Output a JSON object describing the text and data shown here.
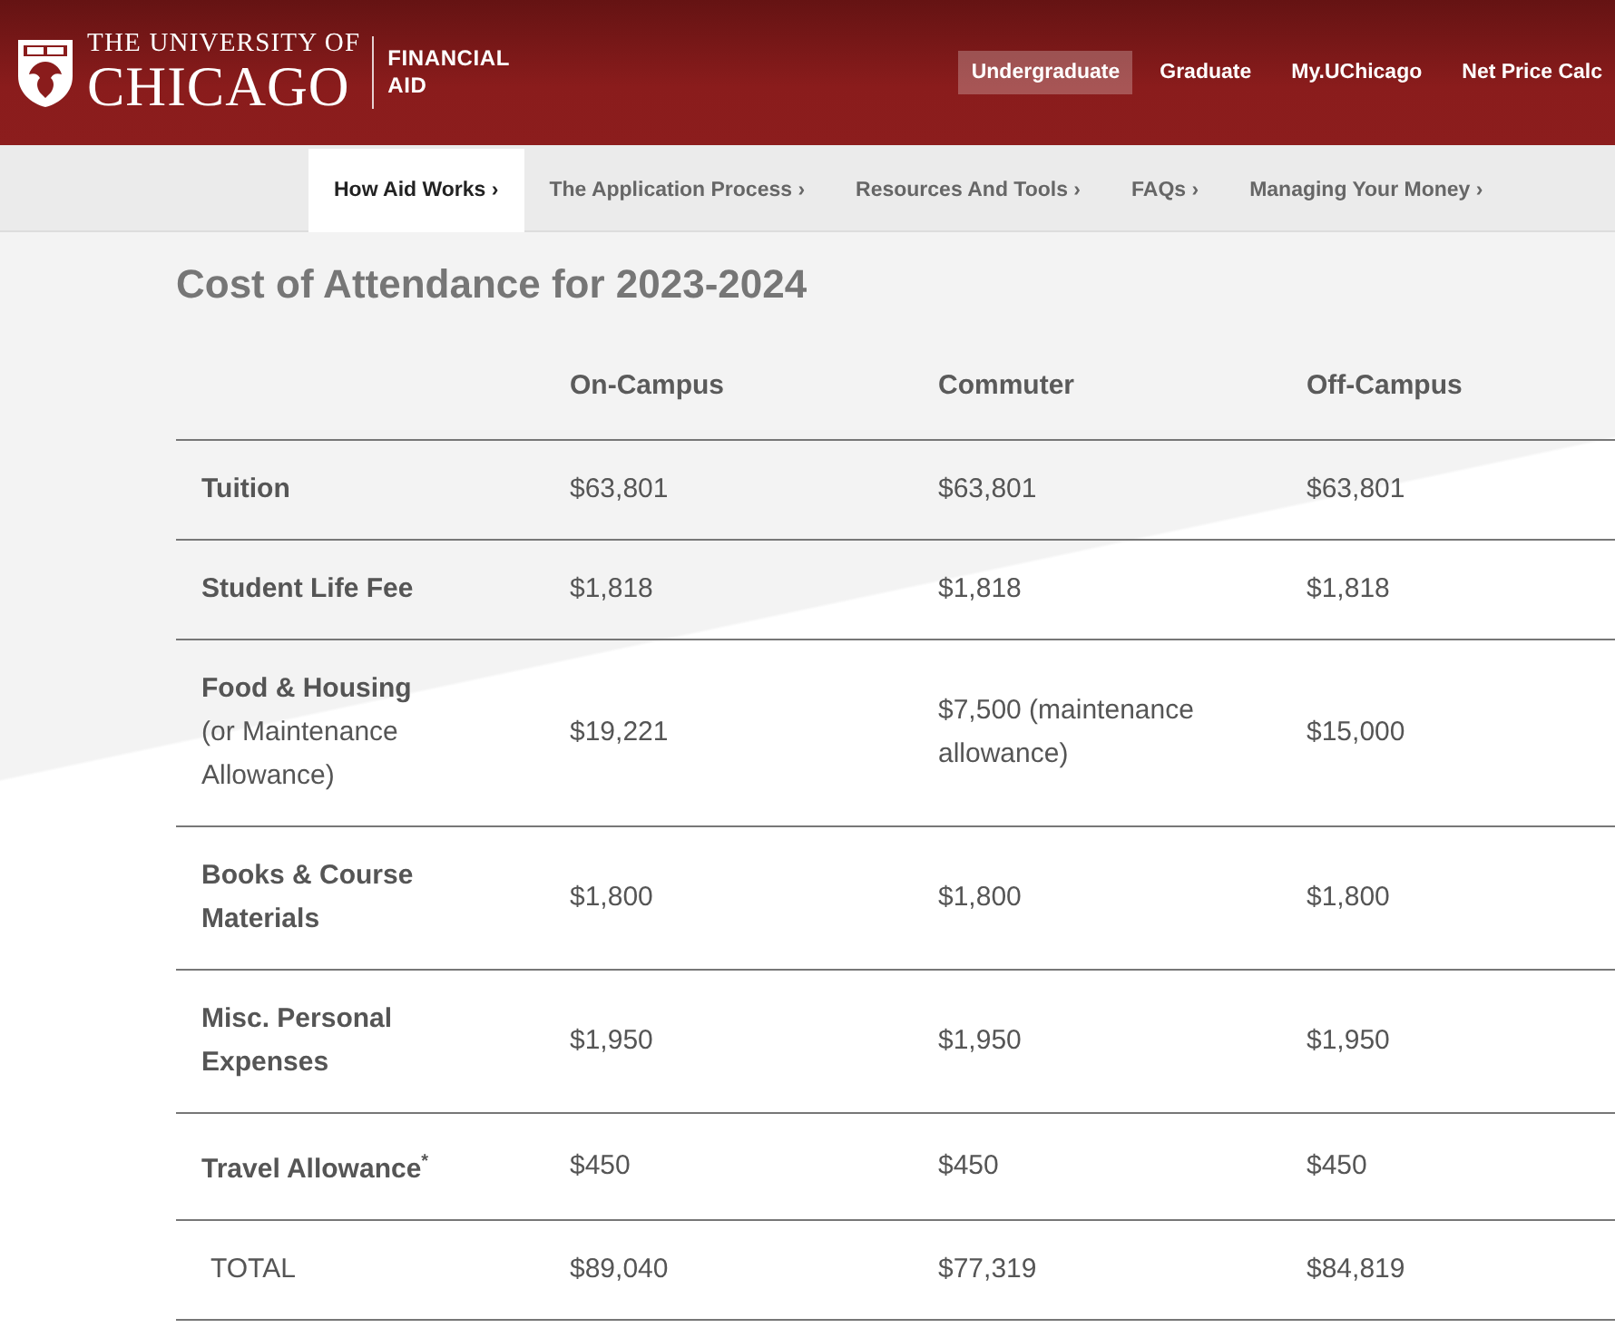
{
  "header": {
    "logo": {
      "line_1": "THE UNIVERSITY OF",
      "line_2": "CHICAGO"
    },
    "site_name": [
      "FINANCIAL",
      "AID"
    ],
    "top_nav": [
      {
        "label": "Undergraduate",
        "selected": true
      },
      {
        "label": "Graduate",
        "selected": false
      },
      {
        "label": "My.UChicago",
        "selected": false
      },
      {
        "label": "Net Price Calc",
        "selected": false
      }
    ]
  },
  "sub_nav": [
    {
      "label": "How Aid Works ›",
      "selected": true
    },
    {
      "label": "The Application Process ›",
      "selected": false
    },
    {
      "label": "Resources And Tools ›",
      "selected": false
    },
    {
      "label": "FAQs ›",
      "selected": false
    },
    {
      "label": "Managing Your Money ›",
      "selected": false
    }
  ],
  "title": "Cost of Attendance for 2023-2024",
  "table": {
    "columns": [
      "On-Campus",
      "Commuter",
      "Off-Campus"
    ],
    "rows": [
      {
        "kind": "item",
        "label": "Tuition",
        "values": [
          "$63,801",
          "$63,801",
          "$63,801"
        ]
      },
      {
        "kind": "item",
        "label": "Student Life Fee",
        "values": [
          "$1,818",
          "$1,818",
          "$1,818"
        ]
      },
      {
        "kind": "item",
        "label": "Food & Housing",
        "note": "(or Maintenance Allowance)",
        "values": [
          "$19,221",
          "$7,500 (maintenance allowance)",
          "$15,000"
        ]
      },
      {
        "kind": "item",
        "label": "Books & Course Materials",
        "values": [
          "$1,800",
          "$1,800",
          "$1,800"
        ]
      },
      {
        "kind": "item",
        "label": "Misc. Personal Expenses",
        "values": [
          "$1,950",
          "$1,950",
          "$1,950"
        ]
      },
      {
        "kind": "item",
        "label": "Travel Allowance$^{*}$",
        "values": [
          "$450",
          "$450",
          "$450"
        ]
      },
      {
        "kind": "total",
        "label": "TOTAL",
        "values": [
          "$89,040",
          "$77,319",
          "$84,819"
        ]
      }
    ]
  }
}
